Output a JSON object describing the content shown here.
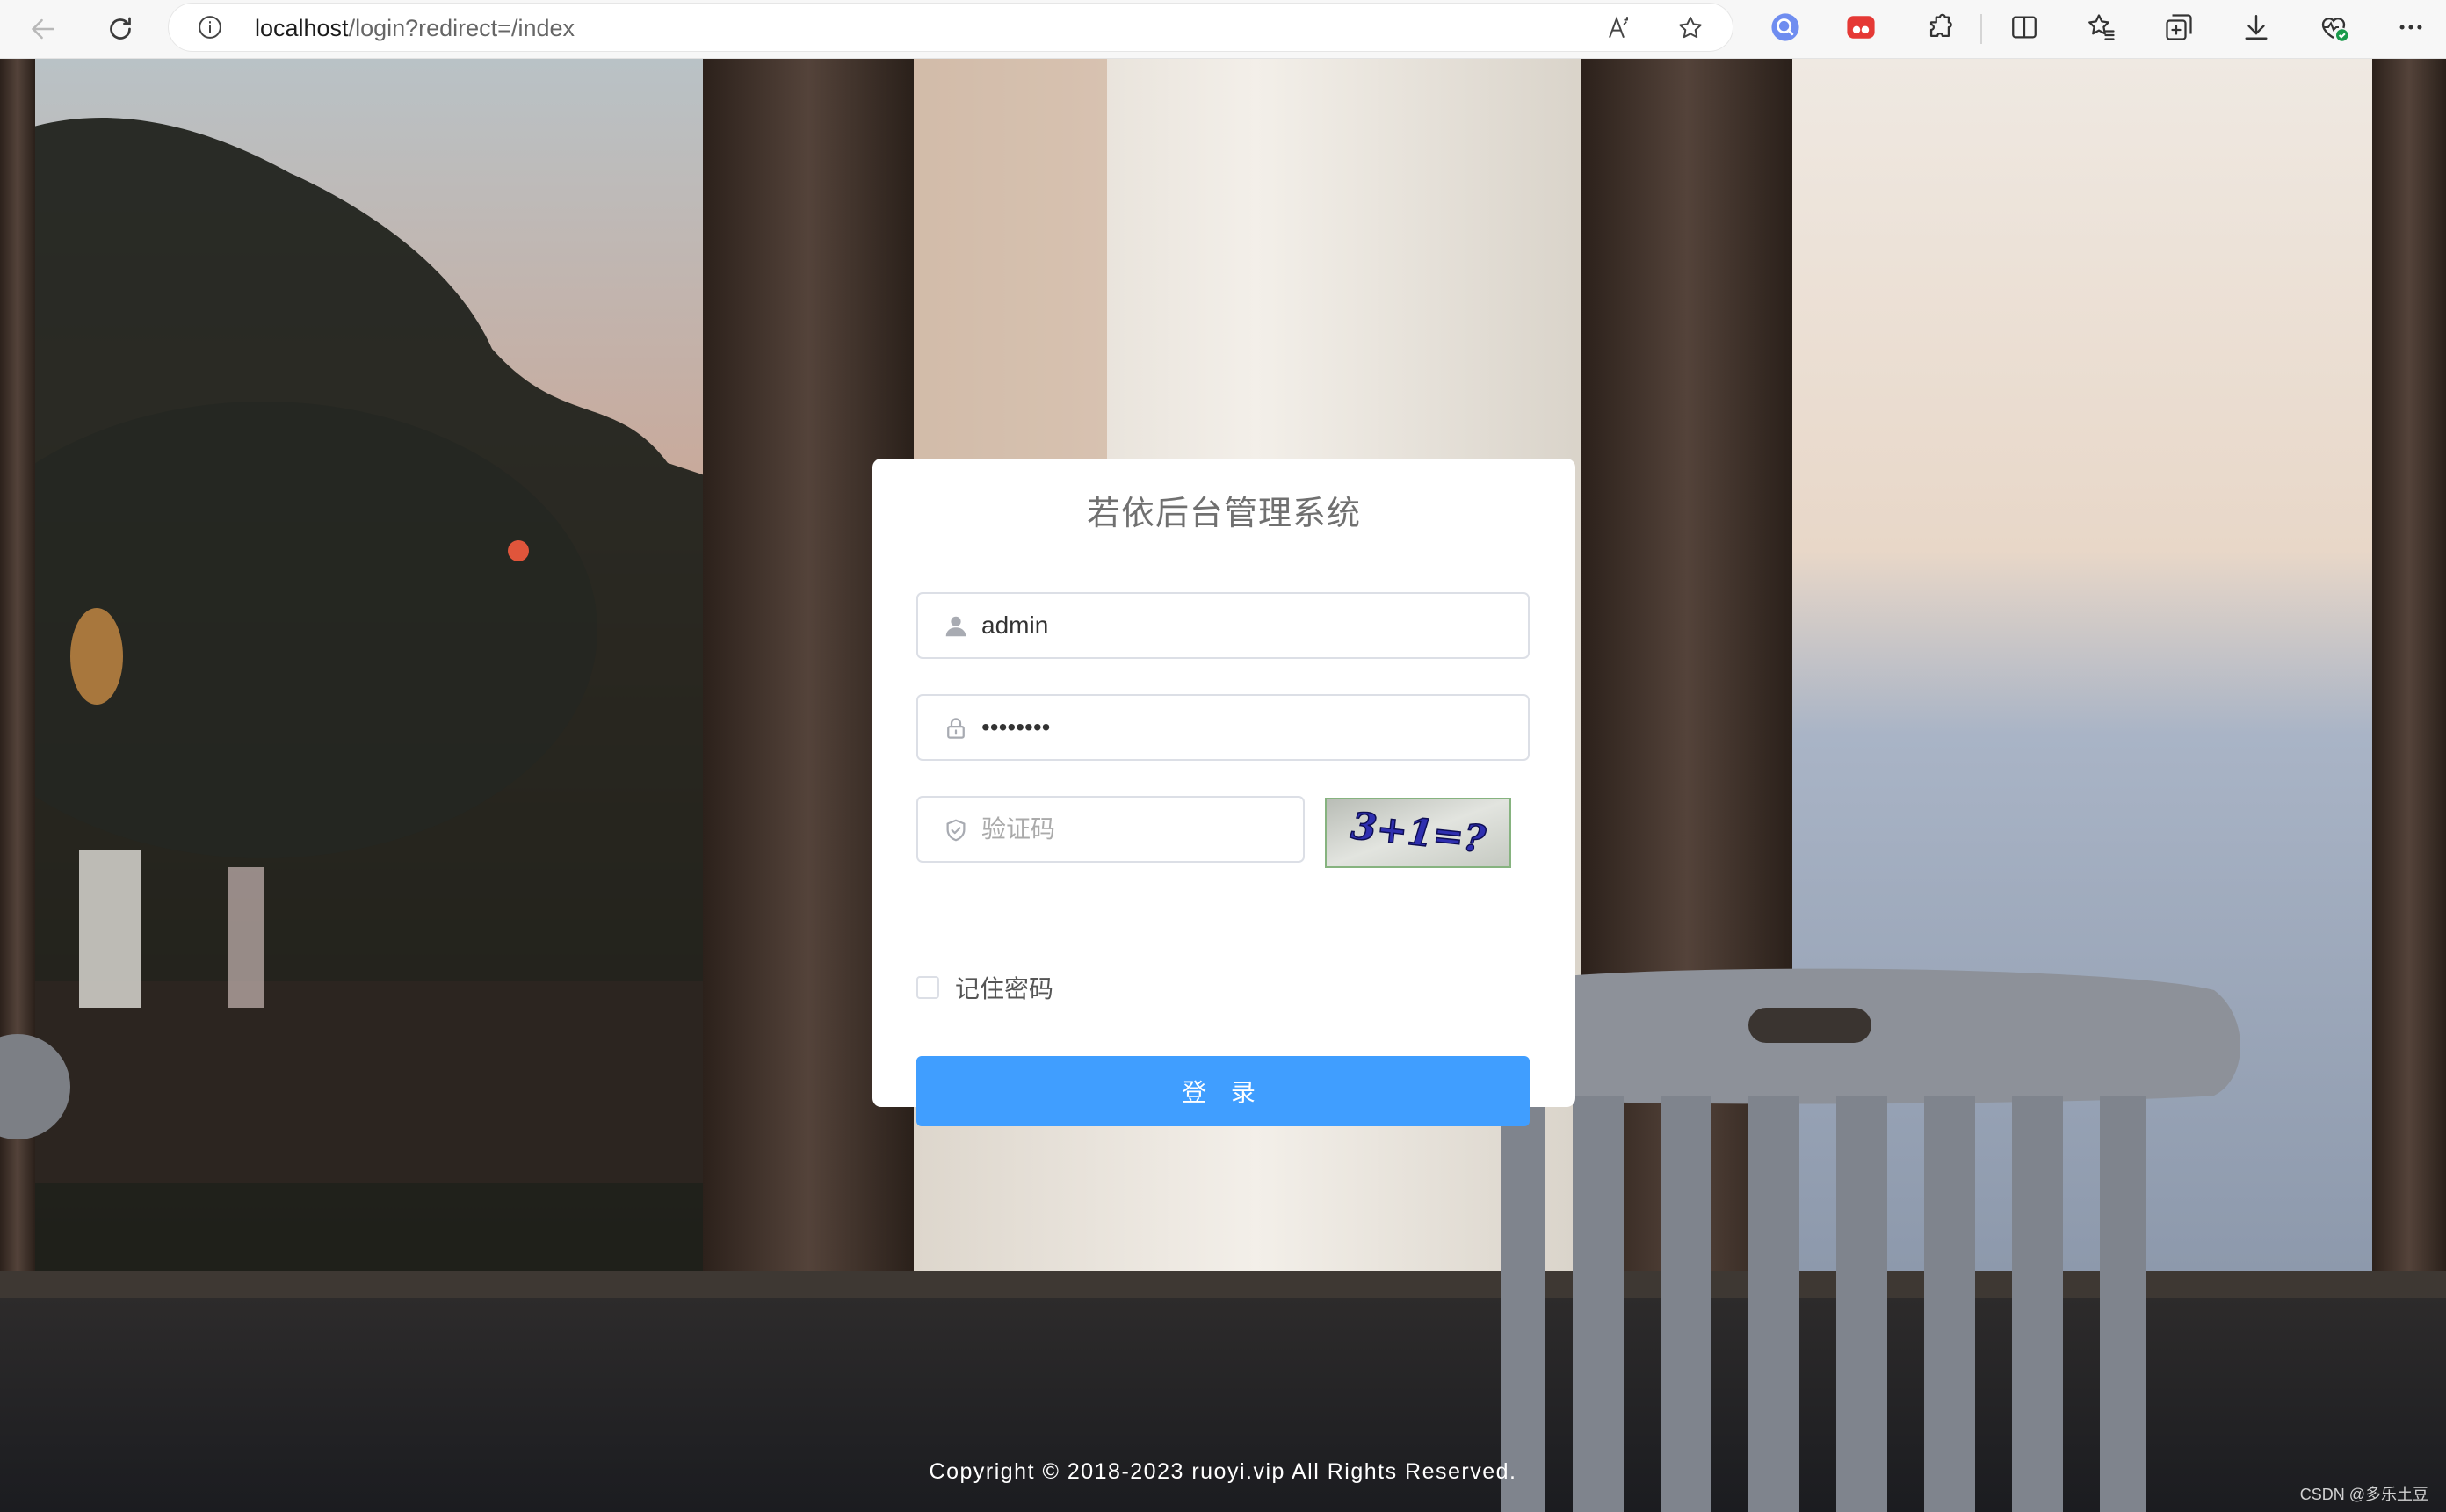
{
  "browser": {
    "url_host": "localhost",
    "url_path": "/login?redirect=/index"
  },
  "icons": {
    "back": "back-arrow-icon",
    "refresh": "refresh-icon",
    "info": "info-icon",
    "read_aloud": "read-aloud-icon",
    "favorite": "star-icon",
    "search_ext": "search-extension-icon",
    "red_ext": "red-extension-icon",
    "extensions": "puzzle-icon",
    "split": "split-screen-icon",
    "favorites": "favorites-icon",
    "collections": "collections-icon",
    "download": "download-icon",
    "health": "browser-health-icon",
    "more": "more-icon"
  },
  "login": {
    "title": "若依后台管理系统",
    "username": "admin",
    "password": "••••••••",
    "captcha_placeholder": "验证码",
    "captcha_text": "3+1=?",
    "remember_label": "记住密码",
    "submit_label": "登 录"
  },
  "footer": {
    "copyright": "Copyright © 2018-2023 ruoyi.vip All Rights Reserved.",
    "watermark": "CSDN @多乐土豆"
  },
  "colors": {
    "primary": "#409eff",
    "card": "#ffffff",
    "captcha_border": "#86b37f"
  }
}
